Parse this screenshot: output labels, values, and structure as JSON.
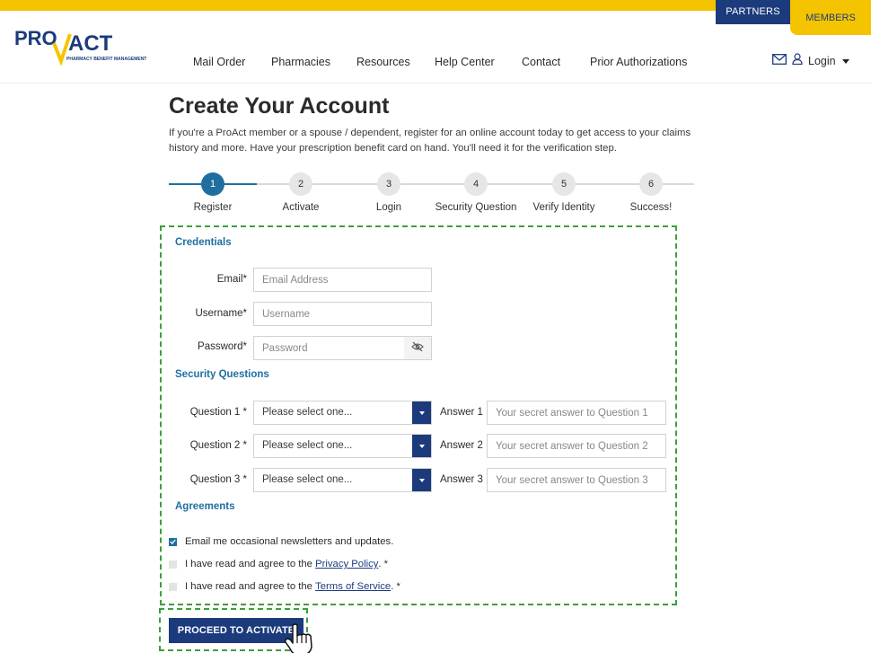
{
  "header": {
    "tab_partners": "PARTNERS",
    "tab_members": "MEMBERS",
    "logo_text_pro": "PRO",
    "logo_text_act": "ACT",
    "logo_tagline": "PHARMACY BENEFIT MANAGEMENT",
    "nav": [
      "Mail Order",
      "Pharmacies",
      "Resources",
      "Help Center",
      "Contact",
      "Prior Authorizations"
    ],
    "login_label": "Login",
    "mail_icon": "mail-icon",
    "user_icon": "user-icon"
  },
  "page": {
    "title": "Create Your Account",
    "intro": "If you're a ProAct member or a spouse / dependent, register for an online account today to get access to your claims history and more. Have your prescription benefit card on hand. You'll need it for the verification step."
  },
  "steps": [
    {
      "num": "1",
      "label": "Register",
      "active": true
    },
    {
      "num": "2",
      "label": "Activate",
      "active": false
    },
    {
      "num": "3",
      "label": "Login",
      "active": false
    },
    {
      "num": "4",
      "label": "Security Question",
      "active": false
    },
    {
      "num": "5",
      "label": "Verify Identity",
      "active": false
    },
    {
      "num": "6",
      "label": "Success!",
      "active": false
    }
  ],
  "credentials": {
    "heading": "Credentials",
    "email_label": "Email*",
    "email_placeholder": "Email Address",
    "username_label": "Username*",
    "username_placeholder": "Username",
    "password_label": "Password*",
    "password_placeholder": "Password"
  },
  "security": {
    "heading": "Security Questions",
    "questions": [
      {
        "label": "Question 1 *",
        "selected": "Please select one...",
        "answer_label": "Answer 1",
        "answer_placeholder": "Your secret answer to Question 1"
      },
      {
        "label": "Question 2 *",
        "selected": "Please select one...",
        "answer_label": "Answer 2",
        "answer_placeholder": "Your secret answer to Question 2"
      },
      {
        "label": "Question 3 *",
        "selected": "Please select one...",
        "answer_label": "Answer 3",
        "answer_placeholder": "Your secret answer to Question 3"
      }
    ]
  },
  "agreements": {
    "heading": "Agreements",
    "newsletter": "Email me occasional newsletters and updates.",
    "newsletter_checked": true,
    "privacy_prefix": "I have read and agree to the ",
    "privacy_link": "Privacy Policy",
    "privacy_suffix": ". *",
    "terms_prefix": "I have read and agree to the ",
    "terms_link": "Terms of Service",
    "terms_suffix": ". *"
  },
  "actions": {
    "proceed": "PROCEED TO ACTIVATE"
  },
  "colors": {
    "brand_yellow": "#f5c400",
    "brand_navy": "#1c3b7d",
    "accent_blue": "#1e6fa0",
    "highlight_green": "#3ba03b"
  }
}
